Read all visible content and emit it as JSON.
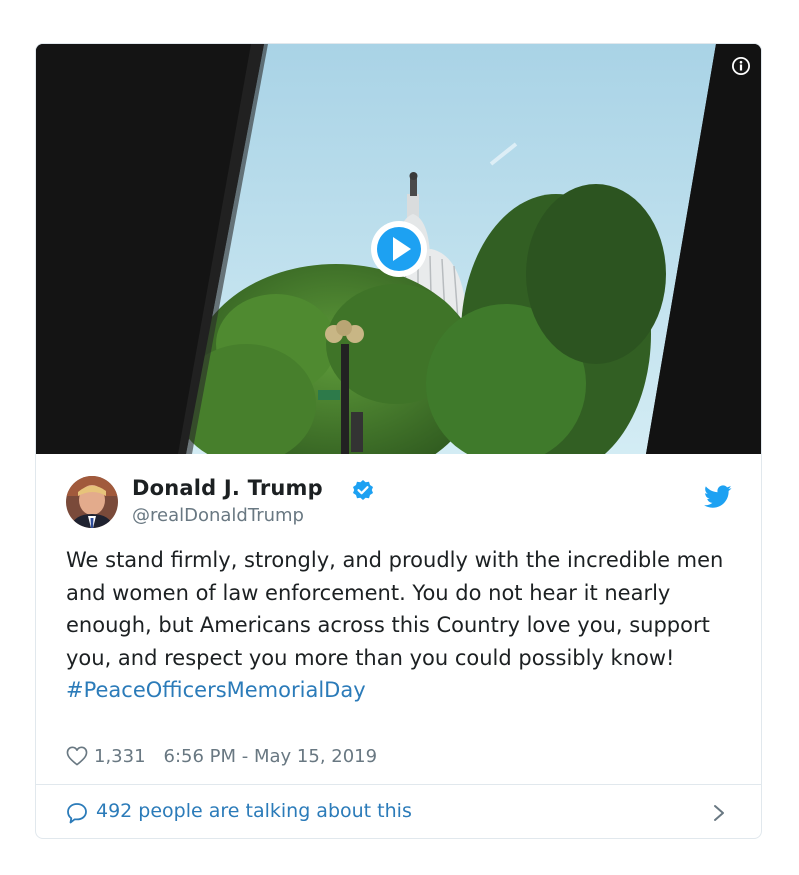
{
  "tweet": {
    "author_name": "Donald J. Trump",
    "author_handle": "@realDonaldTrump",
    "text": "We stand firmly, strongly, and proudly with the incredible men and women of law enforcement. You do not hear it nearly enough, but Americans across this Country love you, support you, and respect you more than you could possibly know!",
    "hashtag": "#PeaceOfficersMemorialDay",
    "likes": "1,331",
    "timestamp": "6:56 PM - May 15, 2019",
    "conversation": "492 people are talking about this"
  },
  "icons": {
    "info": "info-icon",
    "play": "play-icon",
    "verified": "verified-badge-icon",
    "platform": "twitter-bird-icon",
    "like": "heart-icon",
    "reply": "speech-bubble-icon",
    "more": "chevron-right-icon"
  },
  "colors": {
    "accent": "#1da1f2",
    "link": "#2b7bb9",
    "muted": "#697882",
    "text": "#1c2022",
    "border": "#e1e8ed"
  }
}
